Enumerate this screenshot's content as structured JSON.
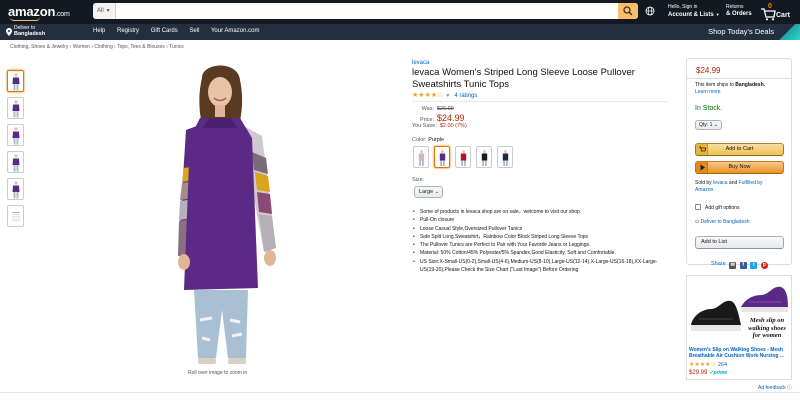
{
  "nav": {
    "logo_text": "amazon",
    "logo_tld": ".com",
    "search_category": "All",
    "search_placeholder": "",
    "account_greeting": "Hello, Sign in",
    "account_label": "Account & Lists",
    "returns_line1": "Returns",
    "returns_line2": "& Orders",
    "cart_count": "0",
    "cart_label": "Cart",
    "deliver_line1": "Deliver to",
    "deliver_line2": "Bangladesh",
    "links": [
      "Help",
      "Registry",
      "Gift Cards",
      "Sell",
      "Your Amazon.com"
    ],
    "deals_label": "Shop Today's Deals"
  },
  "breadcrumb": "Clothing, Shoes & Jewelry  ›  Women  ›  Clothing  ›  Tops, Tees & Blouses  ›  Tunics",
  "gallery": {
    "thumb_colors": [
      "#5b2a86",
      "#5b2a86",
      "#5b2a86",
      "#5b2a86",
      "#5b2a86",
      "#d9d9d9"
    ],
    "zoom_hint": "Roll over image to zoom in"
  },
  "product": {
    "brand": "levaca",
    "title": "levaca Women's Striped Long Sleeve Loose Pullover Sweatshirts Tunic Tops",
    "stars": "★★★★☆",
    "ratings_text": "4 ratings",
    "was_label": "Was:",
    "was_value": "$26.99",
    "price_label": "Price:",
    "price_value": "$24.99",
    "save_label": "You Save:",
    "save_value": "$2.00 (7%)",
    "color_label": "Color:",
    "color_value": "Purple",
    "swatch_colors": [
      "#c9b4c8",
      "#5b2a86",
      "#a8162e",
      "#1a1a1a",
      "#1a1a1a",
      "#1d2a44"
    ],
    "size_label": "Size:",
    "size_value": "Large",
    "bullets": [
      "Some of products in levaca shop are on sale，welcome to visit our shop.",
      "Pull-On closure",
      "Loose Casual Style,Oversized Pullover Tunics",
      "Side Split Long Sweatshirt，Rainbow Color Block Striped Long Sleeve Tops",
      "The Pullover Tunics are Perfect to Pair with Your Favorite Jeans or Leggings.",
      "Material: 50% Cotton/45% Polyester/5% Spandex,Good Elasticity, Soft and Comfortable.",
      "US Size:X-Small-US(0-2),Small-US(4-6),Medium-US(8-10),Large-US(12-14),X-Large-US(16-18),XX-Large-US(19-20),Please Check the Size Chart (\"Last Image\") Before Ordering"
    ]
  },
  "buybox": {
    "price": "$24.99",
    "ships_text": "This item ships to",
    "ships_dest": "Bangladesh.",
    "learn_more": "Learn more",
    "stock": "In Stock.",
    "qty_label": "Qty:",
    "qty_value": "1",
    "add_to_cart": "Add to Cart",
    "buy_now": "Buy Now",
    "sold_by_prefix": "Sold by",
    "seller": "levaca",
    "sold_by_mid": "and",
    "fulfilled": "Fulfilled by",
    "fulfilled_by": "Amazon.",
    "gift_options": "Add gift options",
    "deliver_to": "Deliver to Bangladesh",
    "add_to_list": "Add to List",
    "share_label": "Share"
  },
  "ad": {
    "tagline": "Mesh slip on walking shoes for women",
    "title": "Women's Slip on Walking Shoes - Mesh Breathable Air Cushion Work Nursing ...",
    "stars": "★★★★☆",
    "rating_count": "264",
    "price": "$29.99",
    "prime": "✓prime",
    "feedback": "Ad feedback"
  },
  "colors": {
    "nav_bg": "#131921",
    "nav_bottom_bg": "#232f3e",
    "accent_orange": "#febd69",
    "price_red": "#b12704",
    "link_blue": "#0066c0",
    "stock_green": "#007600",
    "product_purple": "#5b2a86"
  },
  "icons": {
    "search": "search-icon",
    "globe": "globe-icon",
    "cart": "cart-icon",
    "location": "location-pin-icon"
  }
}
